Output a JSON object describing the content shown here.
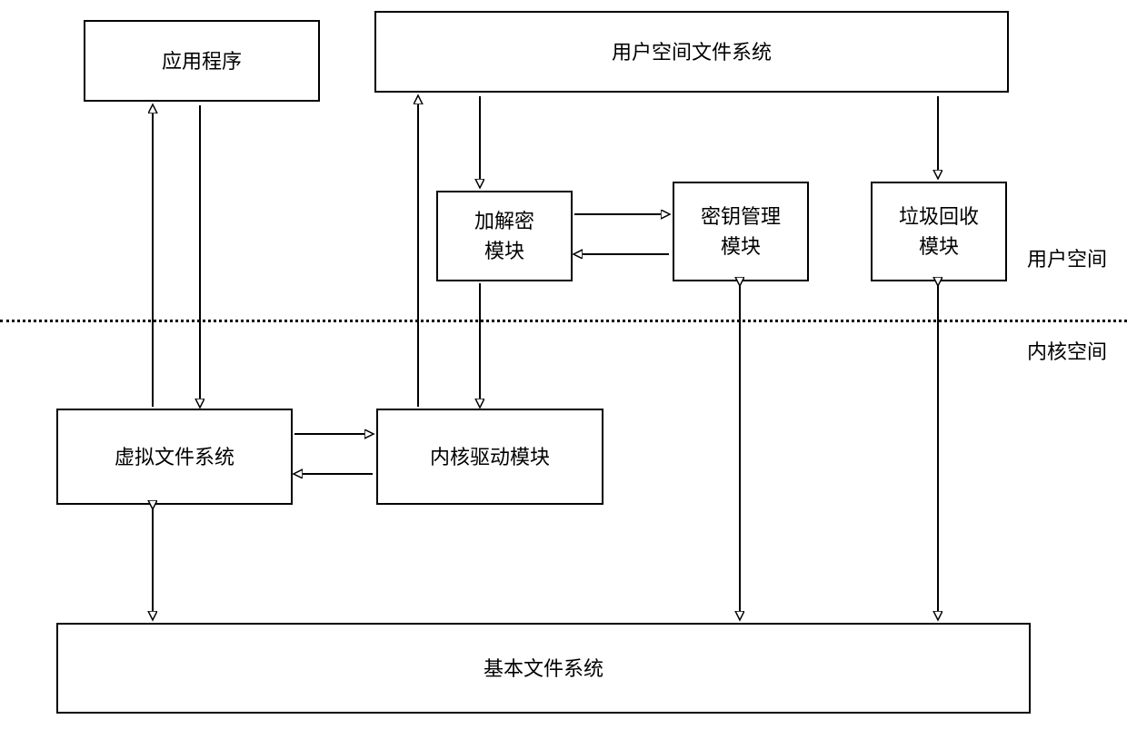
{
  "boxes": {
    "app": "应用程序",
    "userfs": "用户空间文件系统",
    "crypto": "加解密\n模块",
    "keymgr": "密钥管理\n模块",
    "gc": "垃圾回收\n模块",
    "vfs": "虚拟文件系统",
    "kdrv": "内核驱动模块",
    "basefs": "基本文件系统"
  },
  "labels": {
    "userspace": "用户空间",
    "kernelspace": "内核空间"
  }
}
